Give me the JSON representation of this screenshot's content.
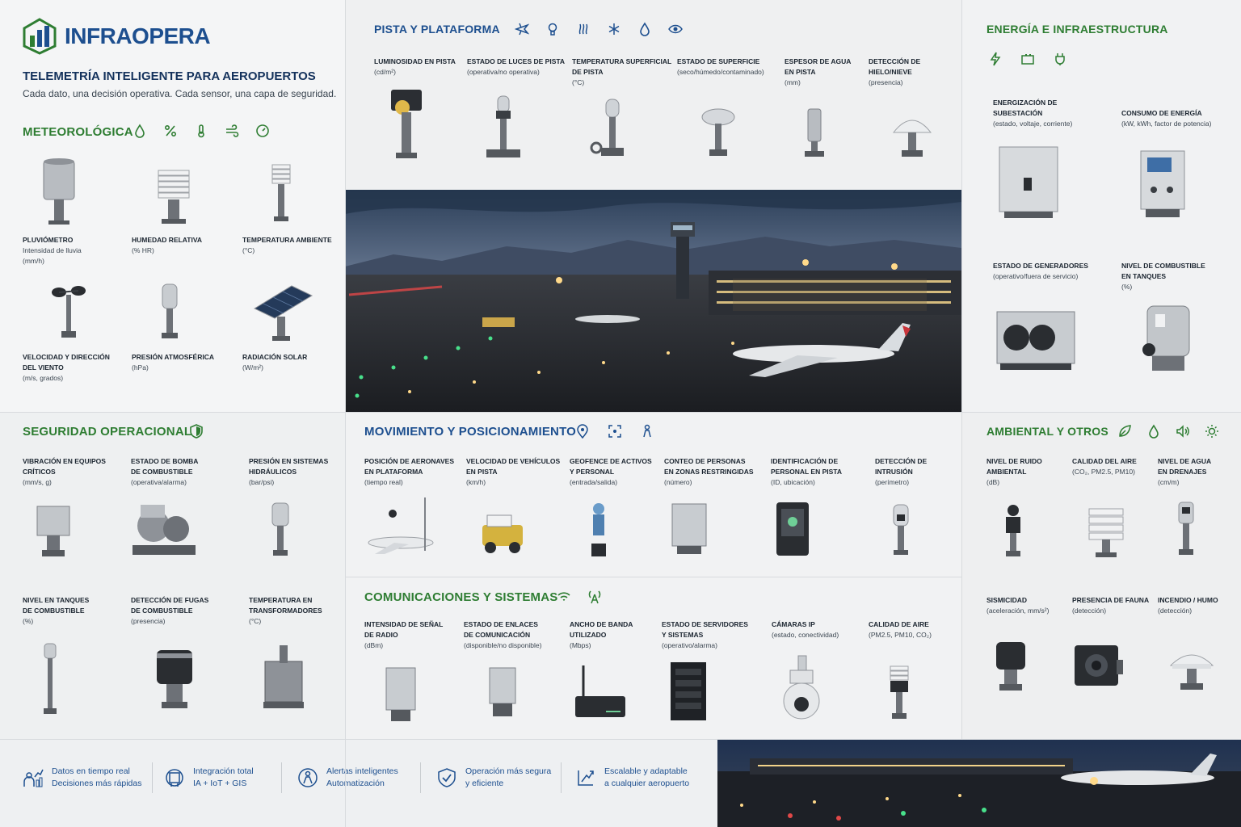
{
  "brand": {
    "name": "INFRAOPERA",
    "tagline": "TELEMETRÍA INTELIGENTE PARA AEROPUERTOS",
    "subtagline": "Cada dato, una decisión operativa. Cada sensor, una capa de seguridad."
  },
  "sections": {
    "meteo": {
      "title": "METEOROLÓGICA",
      "icons": [
        "droplet-icon",
        "percent-icon",
        "thermometer-icon",
        "wind-icon",
        "gauge-icon"
      ],
      "items": [
        {
          "label": "PLUVIÓMETRO",
          "sub": "Intensidad de lluvia",
          "sub2": "(mm/h)",
          "device": "rain-gauge"
        },
        {
          "label": "HUMEDAD RELATIVA",
          "sub": "(% HR)",
          "sub2": "",
          "device": "humidity-sensor"
        },
        {
          "label": "TEMPERATURA AMBIENTE",
          "sub": "(°C)",
          "sub2": "",
          "device": "temperature-sensor"
        },
        {
          "label": "VELOCIDAD Y DIRECCIÓN",
          "label2": "DEL VIENTO",
          "sub": "(m/s, grados)",
          "device": "anemometer"
        },
        {
          "label": "PRESIÓN ATMOSFÉRICA",
          "sub": "(hPa)",
          "sub2": "",
          "device": "barometer"
        },
        {
          "label": "RADIACIÓN SOLAR",
          "sub": "(W/m²)",
          "sub2": "",
          "device": "solar-panel"
        }
      ]
    },
    "pista": {
      "title": "PISTA Y PLATAFORMA",
      "icons": [
        "plane-icon",
        "bulb-icon",
        "heat-icon",
        "snowflake-icon",
        "droplet-icon",
        "eye-icon"
      ],
      "items": [
        {
          "label": "LUMINOSIDAD EN PISTA",
          "sub": "(cd/m²)"
        },
        {
          "label": "ESTADO DE LUCES DE PISTA",
          "sub": "(operativa/no operativa)"
        },
        {
          "label": "TEMPERATURA SUPERFICIAL",
          "label2": "DE PISTA",
          "sub": "(°C)"
        },
        {
          "label": "ESTADO DE SUPERFICIE",
          "sub": "(seco/húmedo/contaminado)"
        },
        {
          "label": "ESPESOR DE AGUA",
          "label2": "EN PISTA",
          "sub": "(mm)"
        },
        {
          "label": "DETECCIÓN DE HIELO/NIEVE",
          "sub": "(presencia)"
        }
      ]
    },
    "energia": {
      "title": "ENERGÍA E INFRAESTRUCTURA",
      "icons": [
        "bolt-icon",
        "battery-icon",
        "plug-icon"
      ],
      "items": [
        {
          "label": "ENERGIZACIÓN DE",
          "label2": "SUBESTACIÓN",
          "sub": "(estado, voltaje, corriente)"
        },
        {
          "label": "CONSUMO DE ENERGÍA",
          "sub": "(kW, kWh, factor de potencia)"
        },
        {
          "label": "ESTADO DE GENERADORES",
          "sub": "(operativo/fuera de servicio)"
        },
        {
          "label": "NIVEL DE COMBUSTIBLE",
          "label2": "EN TANQUES",
          "sub": "(%)"
        }
      ]
    },
    "seguridad": {
      "title": "SEGURIDAD OPERACIONAL",
      "icons": [
        "shield-icon"
      ],
      "items": [
        {
          "label": "VIBRACIÓN EN EQUIPOS",
          "label2": "CRÍTICOS",
          "sub": "(mm/s, g)"
        },
        {
          "label": "ESTADO DE BOMBA",
          "label2": "DE COMBUSTIBLE",
          "sub": "(operativa/alarma)"
        },
        {
          "label": "PRESIÓN EN SISTEMAS",
          "label2": "HIDRÁULICOS",
          "sub": "(bar/psi)"
        },
        {
          "label": "NIVEL EN TANQUES",
          "label2": "DE COMBUSTIBLE",
          "sub": "(%)"
        },
        {
          "label": "DETECCIÓN DE FUGAS",
          "label2": "DE COMBUSTIBLE",
          "sub": "(presencia)"
        },
        {
          "label": "TEMPERATURA EN",
          "label2": "TRANSFORMADORES",
          "sub": "(°C)"
        }
      ]
    },
    "movimiento": {
      "title": "MOVIMIENTO Y POSICIONAMIENTO",
      "icons": [
        "location-icon",
        "target-icon",
        "person-icon"
      ],
      "items": [
        {
          "label": "POSICIÓN DE AERONAVES",
          "label2": "EN PLATAFORMA",
          "sub": "(tiempo real)"
        },
        {
          "label": "VELOCIDAD DE VEHÍCULOS",
          "label2": "EN PISTA",
          "sub": "(km/h)"
        },
        {
          "label": "GEOFENCE DE ACTIVOS",
          "label2": "Y PERSONAL",
          "sub": "(entrada/salida)"
        },
        {
          "label": "CONTEO DE PERSONAS",
          "label2": "EN ZONAS RESTRINGIDAS",
          "sub": "(número)"
        },
        {
          "label": "IDENTIFICACIÓN DE",
          "label2": "PERSONAL EN PISTA",
          "sub": "(ID, ubicación)"
        },
        {
          "label": "DETECCIÓN DE",
          "label2": "INTRUSIÓN",
          "sub": "(perímetro)"
        }
      ]
    },
    "comunicaciones": {
      "title": "COMUNICACIONES Y SISTEMAS",
      "icons": [
        "wifi-icon",
        "antenna-icon"
      ],
      "items": [
        {
          "label": "INTENSIDAD DE SEÑAL",
          "label2": "DE RADIO",
          "sub": "(dBm)"
        },
        {
          "label": "ESTADO DE ENLACES",
          "label2": "DE COMUNICACIÓN",
          "sub": "(disponible/no disponible)"
        },
        {
          "label": "ANCHO DE BANDA",
          "label2": "UTILIZADO",
          "sub": "(Mbps)"
        },
        {
          "label": "ESTADO DE SERVIDORES",
          "label2": "Y SISTEMAS",
          "sub": "(operativo/alarma)"
        },
        {
          "label": "CÁMARAS IP",
          "label2": "",
          "sub": "(estado, conectividad)"
        },
        {
          "label": "CALIDAD DE AIRE",
          "label2": "",
          "sub": "(PM2.5, PM10, CO₂)"
        }
      ]
    },
    "ambiental": {
      "title": "AMBIENTAL Y OTROS",
      "icons": [
        "leaf-icon",
        "droplet-icon",
        "speaker-icon",
        "sun-icon"
      ],
      "items": [
        {
          "label": "NIVEL DE RUIDO",
          "label2": "AMBIENTAL",
          "sub": "(dB)"
        },
        {
          "label": "CALIDAD DEL AIRE",
          "label2": "",
          "sub": "(CO₂, PM2.5, PM10)"
        },
        {
          "label": "NIVEL DE AGUA",
          "label2": "EN DRENAJES",
          "sub": "(cm/m)"
        },
        {
          "label": "SISMICIDAD",
          "label2": "",
          "sub": "(aceleración, mm/s²)"
        },
        {
          "label": "PRESENCIA DE FAUNA",
          "label2": "",
          "sub": "(detección)"
        },
        {
          "label": "INCENDIO / HUMO",
          "label2": "",
          "sub": "(detección)"
        }
      ]
    }
  },
  "benefits": [
    {
      "line1": "Datos en tiempo real",
      "line2": "Decisiones más rápidas",
      "icon": "people-chart-icon"
    },
    {
      "line1": "Integración total",
      "line2": "IA + IoT + GIS",
      "icon": "integration-icon"
    },
    {
      "line1": "Alertas inteligentes",
      "line2": "Automatización",
      "icon": "alert-person-icon"
    },
    {
      "line1": "Operación más segura",
      "line2": "y eficiente",
      "icon": "shield-check-icon"
    },
    {
      "line1": "Escalable y adaptable",
      "line2": "a cualquier aeropuerto",
      "icon": "scalable-icon"
    }
  ],
  "colors": {
    "green": "#2e7d32",
    "blue": "#1d4f8f",
    "navy": "#14325c"
  }
}
